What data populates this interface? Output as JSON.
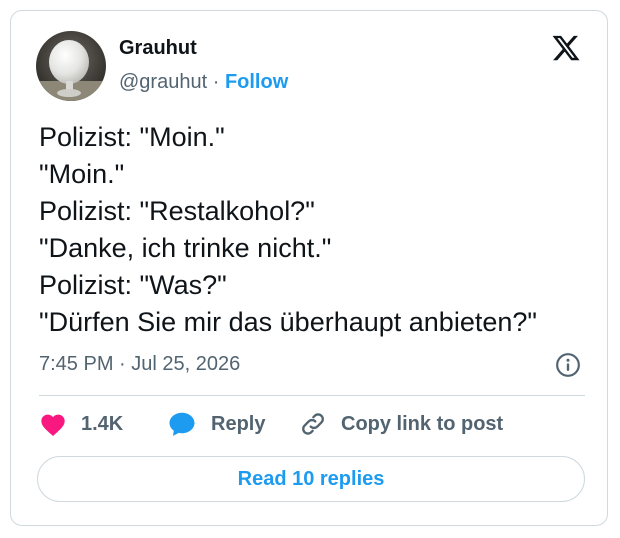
{
  "author": {
    "name": "Grauhut",
    "handle": "@grauhut",
    "separator": "·",
    "follow_label": "Follow"
  },
  "tweet": {
    "lines": [
      "Polizist: \"Moin.\"",
      "\"Moin.\"",
      "Polizist: \"Restalkohol?\"",
      "\"Danke, ich trinke nicht.\"",
      "Polizist: \"Was?\"",
      "\"Dürfen Sie mir das überhaupt anbieten?\""
    ],
    "timestamp": "7:45 PM · Jul 25, 2026"
  },
  "actions": {
    "like_count": "1.4K",
    "reply_label": "Reply",
    "copy_link_label": "Copy link to post"
  },
  "read_replies_label": "Read 10 replies",
  "icons": {
    "brand": "x-logo-icon",
    "info": "info-icon",
    "like": "heart-icon",
    "reply": "speech-bubble-icon",
    "copy": "link-icon"
  },
  "colors": {
    "accent": "#1d9bf0",
    "like": "#f91880",
    "text": "#0f1419",
    "muted": "#536471",
    "border": "#cfd9de"
  }
}
